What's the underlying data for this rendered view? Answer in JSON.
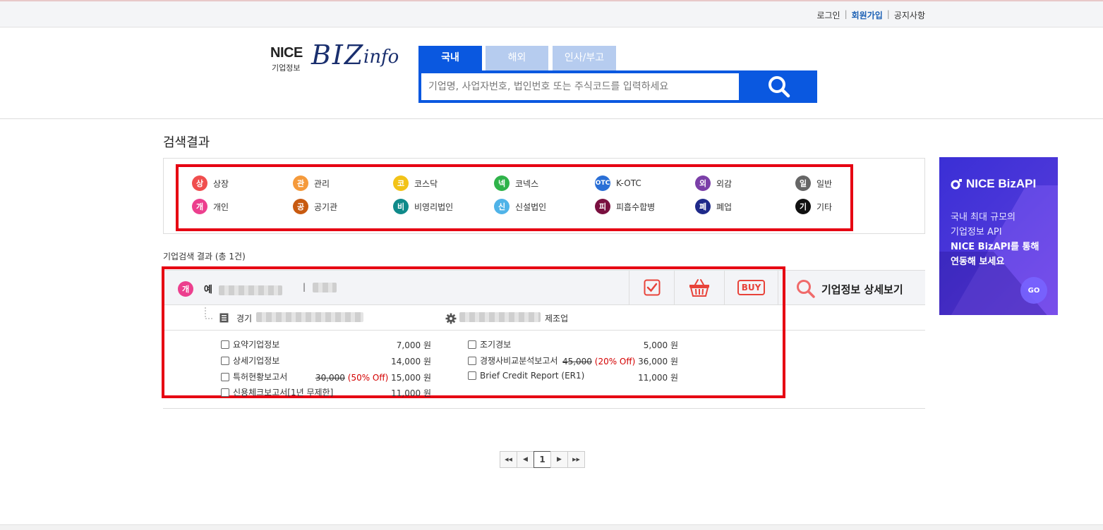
{
  "topbar": {
    "login": "로그인",
    "join": "회원가입",
    "notice": "공지사항",
    "sep": "|"
  },
  "logo": {
    "nice": "NICE",
    "sub": "기업정보",
    "biz": "BIZ",
    "info": "info"
  },
  "search": {
    "tabs": [
      "국내",
      "해외",
      "인사/부고"
    ],
    "placeholder": "기업명, 사업자번호, 법인번호 또는 주식코드를 입력하세요"
  },
  "results": {
    "title": "검색결과",
    "count_line": "기업검색 결과 (총 1건)"
  },
  "legend": [
    {
      "badge": "상",
      "label": "상장",
      "color": "#f04e4e"
    },
    {
      "badge": "관",
      "label": "관리",
      "color": "#f59a3b"
    },
    {
      "badge": "코",
      "label": "코스닥",
      "color": "#f2c318"
    },
    {
      "badge": "넥",
      "label": "코넥스",
      "color": "#2fb34a"
    },
    {
      "badge": "OTC",
      "label": "K-OTC",
      "color": "#2a6fd6"
    },
    {
      "badge": "외",
      "label": "외감",
      "color": "#7b3fa8"
    },
    {
      "badge": "일",
      "label": "일반",
      "color": "#666666"
    },
    {
      "badge": "개",
      "label": "개인",
      "color": "#ec3f8e"
    },
    {
      "badge": "공",
      "label": "공기관",
      "color": "#c85a10"
    },
    {
      "badge": "비",
      "label": "비영리법인",
      "color": "#0f8a8a"
    },
    {
      "badge": "신",
      "label": "신설법인",
      "color": "#4fb3e8"
    },
    {
      "badge": "피",
      "label": "피흡수합병",
      "color": "#7a1040"
    },
    {
      "badge": "폐",
      "label": "폐업",
      "color": "#1f2a8a"
    },
    {
      "badge": "기",
      "label": "기타",
      "color": "#111111"
    }
  ],
  "company": {
    "badge": "개",
    "badge_color": "#ec3f8e",
    "name_prefix": "예",
    "sep": "|",
    "detail_label": "기업정보 상세보기",
    "buy_label": "BUY",
    "region": "경기",
    "industry": "제조업"
  },
  "products": [
    {
      "name": "요약기업정보",
      "price": "7,000 원"
    },
    {
      "name": "상세기업정보",
      "price": "14,000 원"
    },
    {
      "name": "특허현황보고서",
      "orig": "30,000",
      "discount": "(50% Off)",
      "price": "15,000 원"
    },
    {
      "name": "신용체크보고서[1년 무제한]",
      "price": "11,000 원"
    },
    {
      "name": "조기경보",
      "price": "5,000 원"
    },
    {
      "name": "경쟁사비교분석보고서",
      "orig": "45,000",
      "discount": "(20% Off)",
      "price": "36,000 원"
    },
    {
      "name": "Brief Credit Report (ER1)",
      "price": "11,000 원"
    }
  ],
  "pager": {
    "current": "1",
    "first": "◀◀",
    "prev": "◀",
    "next": "▶",
    "last": "▶▶"
  },
  "ad": {
    "brand": "NICE BizAPI",
    "line1": "국내 최대 규모의",
    "line2": "기업정보 API",
    "line3": "NICE BizAPI를 통해",
    "line4": "연동해 보세요",
    "go": "GO"
  }
}
